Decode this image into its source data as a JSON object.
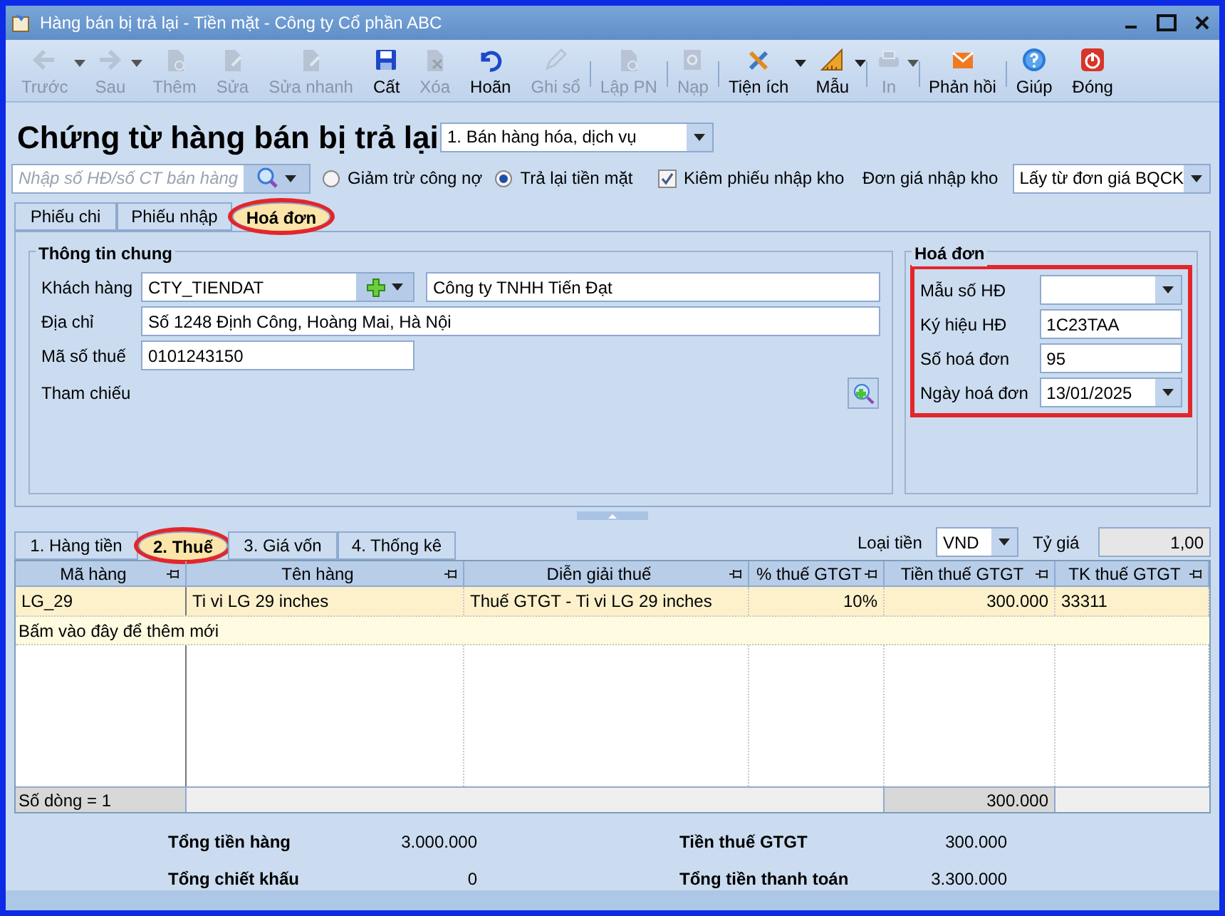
{
  "window": {
    "title": "Hàng bán bị trả lại - Tiền mặt - Công ty Cổ phần ABC"
  },
  "toolbar": [
    {
      "label": "Trước",
      "disabled": true,
      "dropdown": true,
      "separator_before": false
    },
    {
      "label": "Sau",
      "disabled": true,
      "dropdown": true,
      "separator_before": false
    },
    {
      "label": "Thêm",
      "disabled": true,
      "dropdown": false,
      "separator_before": false
    },
    {
      "label": "Sửa",
      "disabled": true,
      "dropdown": false,
      "separator_before": false
    },
    {
      "label": "Sửa nhanh",
      "disabled": true,
      "dropdown": false,
      "separator_before": false
    },
    {
      "label": "Cất",
      "disabled": false,
      "dropdown": false,
      "separator_before": false
    },
    {
      "label": "Xóa",
      "disabled": true,
      "dropdown": false,
      "separator_before": false
    },
    {
      "label": "Hoãn",
      "disabled": false,
      "dropdown": false,
      "separator_before": false
    },
    {
      "label": "Ghi sổ",
      "disabled": true,
      "dropdown": false,
      "separator_before": false
    },
    {
      "label": "Lập PN",
      "disabled": true,
      "dropdown": false,
      "separator_before": true
    },
    {
      "label": "Nạp",
      "disabled": true,
      "dropdown": false,
      "separator_before": true
    },
    {
      "label": "Tiện ích",
      "disabled": false,
      "dropdown": true,
      "separator_before": true
    },
    {
      "label": "Mẫu",
      "disabled": false,
      "dropdown": true,
      "separator_before": false
    },
    {
      "label": "In",
      "disabled": true,
      "dropdown": true,
      "separator_before": true
    },
    {
      "label": "Phản hồi",
      "disabled": false,
      "dropdown": false,
      "separator_before": true
    },
    {
      "label": "Giúp",
      "disabled": false,
      "dropdown": false,
      "separator_before": true
    },
    {
      "label": "Đóng",
      "disabled": false,
      "dropdown": false,
      "separator_before": false
    }
  ],
  "heading": "Chứng từ hàng bán bị trả lại",
  "voucher_type": {
    "value": "1. Bán hàng hóa, dịch vụ"
  },
  "search": {
    "placeholder": "Nhập số HĐ/số CT bán hàng"
  },
  "options": [
    {
      "kind": "radio",
      "label": "Giảm trừ công nợ",
      "checked": false
    },
    {
      "kind": "radio",
      "label": "Trả lại tiền mặt",
      "checked": true
    },
    {
      "kind": "checkbox",
      "label": "Kiêm phiếu nhập kho",
      "checked": true
    }
  ],
  "unit_price": {
    "label": "Đơn giá nhập kho",
    "value": "Lấy từ đơn giá BQCK"
  },
  "tabs": [
    {
      "label": "Phiếu chi",
      "selected": false,
      "highlighted": false
    },
    {
      "label": "Phiếu nhập",
      "selected": false,
      "highlighted": false
    },
    {
      "label": "Hoá đơn",
      "selected": true,
      "highlighted": true
    }
  ],
  "general": {
    "title": "Thông tin chung",
    "customer": {
      "label": "Khách hàng",
      "code": "CTY_TIENDAT",
      "name": "Công ty TNHH Tiến Đạt"
    },
    "address": {
      "label": "Địa chỉ",
      "value": "Số 1248 Định Công, Hoàng Mai, Hà Nội"
    },
    "tax_code": {
      "label": "Mã số thuế",
      "value": "0101243150"
    },
    "reference": {
      "label": "Tham chiếu"
    }
  },
  "invoice": {
    "title": "Hoá đơn",
    "highlighted": true,
    "fields": [
      {
        "kind": "dropdown",
        "label": "Mẫu số HĐ"
      },
      {
        "kind": "text",
        "label": "Ký hiệu HĐ",
        "value": "1C23TAA"
      },
      {
        "kind": "text",
        "label": "Số hoá đơn",
        "value": "95"
      },
      {
        "kind": "dropdown",
        "label": "Ngày hoá đơn",
        "value": "13/01/2025"
      }
    ]
  },
  "detail_tabs": [
    {
      "label": "1. Hàng tiền",
      "selected": false,
      "highlighted": false
    },
    {
      "label": "2. Thuế",
      "selected": true,
      "highlighted": true
    },
    {
      "label": "3. Giá vốn",
      "selected": false,
      "highlighted": false
    },
    {
      "label": "4. Thống kê",
      "selected": false,
      "highlighted": false
    }
  ],
  "currency": {
    "label": "Loại tiền",
    "value": "VND"
  },
  "rate": {
    "label": "Tỷ giá",
    "value": "1,00"
  },
  "table": {
    "columns": [
      {
        "label": "Mã hàng"
      },
      {
        "label": "Tên hàng"
      },
      {
        "label": "Diễn giải thuế"
      },
      {
        "label": "% thuế GTGT"
      },
      {
        "label": "Tiền thuế GTGT"
      },
      {
        "label": "TK thuế GTGT"
      }
    ],
    "rows": [
      {
        "selected": true,
        "cells": [
          "LG_29",
          "Ti vi LG 29 inches",
          "Thuế GTGT - Ti vi LG 29 inches",
          "10%",
          "300.000",
          "33311"
        ]
      }
    ],
    "add_row_hint": "Bấm vào đây để thêm mới",
    "footer": {
      "count": "Số dòng = 1",
      "tax_total": "300.000"
    }
  },
  "totals": [
    {
      "label": "Tổng tiền hàng",
      "value": "3.000.000"
    },
    {
      "label": "Tiền thuế GTGT",
      "value": "300.000"
    },
    {
      "label": "Tổng chiết khấu",
      "value": "0"
    },
    {
      "label": "Tổng tiền thanh toán",
      "value": "3.300.000"
    }
  ]
}
